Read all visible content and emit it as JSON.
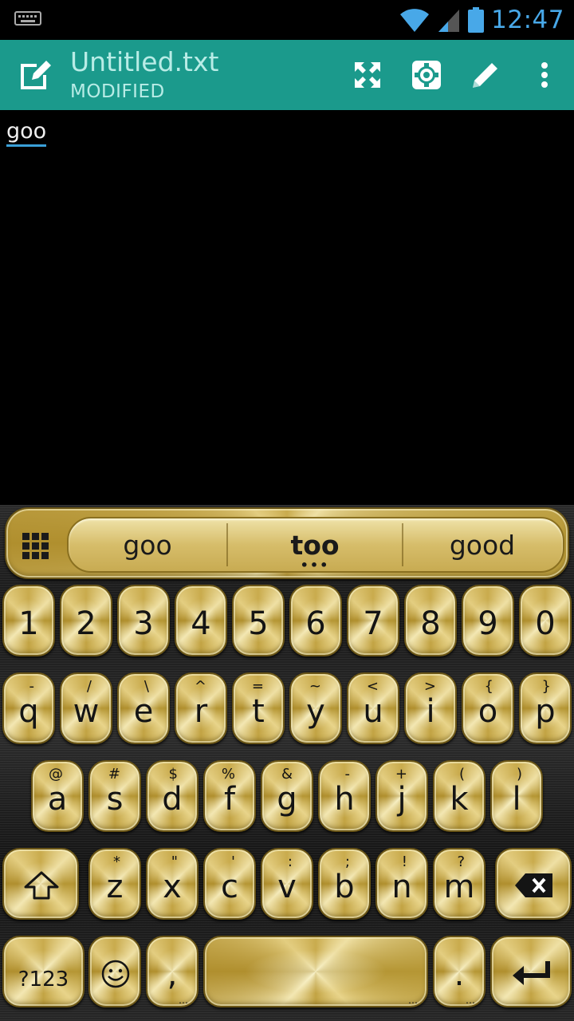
{
  "status_bar": {
    "time": "12:47",
    "icons": [
      "keyboard-icon",
      "wifi-icon",
      "signal-icon",
      "battery-icon"
    ],
    "time_color": "#48a8e8"
  },
  "app_bar": {
    "title": "Untitled.txt",
    "subtitle": "MODIFIED",
    "background": "#1b9a8c",
    "actions": [
      "fullscreen-icon",
      "settings-icon",
      "pencil-icon",
      "overflow-menu-icon"
    ]
  },
  "editor": {
    "text": "goo"
  },
  "keyboard": {
    "suggestions": [
      "goo",
      "too",
      "good"
    ],
    "number_row": [
      {
        "label": "1"
      },
      {
        "label": "2"
      },
      {
        "label": "3"
      },
      {
        "label": "4"
      },
      {
        "label": "5"
      },
      {
        "label": "6"
      },
      {
        "label": "7"
      },
      {
        "label": "8"
      },
      {
        "label": "9"
      },
      {
        "label": "0"
      }
    ],
    "row1": [
      {
        "label": "q",
        "hint": "-"
      },
      {
        "label": "w",
        "hint": "/"
      },
      {
        "label": "e",
        "hint": "\\"
      },
      {
        "label": "r",
        "hint": "^"
      },
      {
        "label": "t",
        "hint": "="
      },
      {
        "label": "y",
        "hint": "~"
      },
      {
        "label": "u",
        "hint": "<"
      },
      {
        "label": "i",
        "hint": ">"
      },
      {
        "label": "o",
        "hint": "{"
      },
      {
        "label": "p",
        "hint": "}"
      }
    ],
    "row2": [
      {
        "label": "a",
        "hint": "@"
      },
      {
        "label": "s",
        "hint": "#"
      },
      {
        "label": "d",
        "hint": "$"
      },
      {
        "label": "f",
        "hint": "%"
      },
      {
        "label": "g",
        "hint": "&"
      },
      {
        "label": "h",
        "hint": "-"
      },
      {
        "label": "j",
        "hint": "+"
      },
      {
        "label": "k",
        "hint": "("
      },
      {
        "label": "l",
        "hint": ")"
      }
    ],
    "row3": [
      {
        "label": "z",
        "hint": "*"
      },
      {
        "label": "x",
        "hint": "\""
      },
      {
        "label": "c",
        "hint": "'"
      },
      {
        "label": "v",
        "hint": ":"
      },
      {
        "label": "b",
        "hint": ";"
      },
      {
        "label": "n",
        "hint": "!"
      },
      {
        "label": "m",
        "hint": "?"
      }
    ],
    "symbols_label": "?123",
    "comma_label": ",",
    "period_label": ".",
    "ellipsis": "…",
    "suggestion_more": "•••"
  }
}
